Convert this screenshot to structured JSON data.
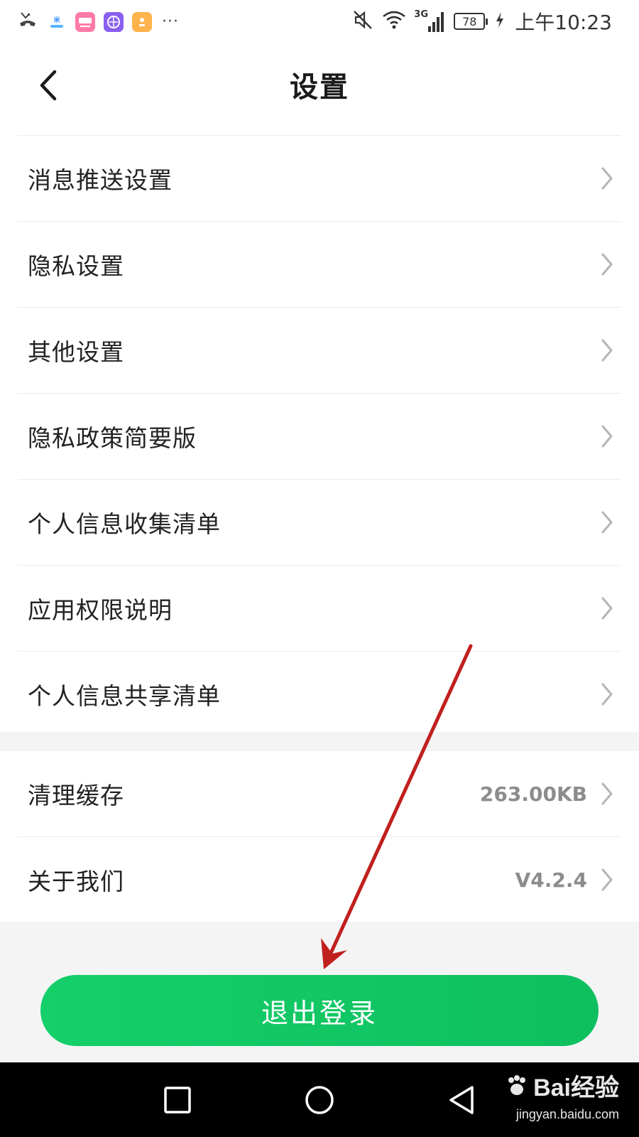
{
  "status_bar": {
    "battery": "78",
    "network": "3G",
    "time": "上午10:23",
    "app_icons": [
      "missed-call-icon",
      "mijia-app-icon",
      "meituan-app-icon",
      "browser-app-icon",
      "wallet-app-icon"
    ],
    "more": "···"
  },
  "header": {
    "title": "设置"
  },
  "settings": {
    "items": [
      {
        "label": "消息推送设置"
      },
      {
        "label": "隐私设置"
      },
      {
        "label": "其他设置"
      },
      {
        "label": "隐私政策简要版"
      },
      {
        "label": "个人信息收集清单"
      },
      {
        "label": "应用权限说明"
      },
      {
        "label": "个人信息共享清单"
      }
    ]
  },
  "other": {
    "cache": {
      "label": "清理缓存",
      "value": "263.00KB"
    },
    "about": {
      "label": "关于我们",
      "value": "V4.2.4"
    }
  },
  "logout": {
    "label": "退出登录"
  },
  "watermark": {
    "logo": "Bai经验",
    "site": "jingyan.baidu.com"
  },
  "colors": {
    "accent": "#12c865",
    "annotation": "#c0201e",
    "separator": "#f4f4f4"
  }
}
